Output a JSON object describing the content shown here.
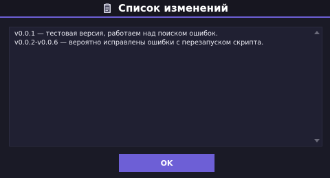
{
  "dialog": {
    "title": "Список изменений",
    "title_icon": "clipboard-icon"
  },
  "changelog": {
    "lines": [
      "v0.0.1 — тестовая версия, работаем над поиском ошибок.",
      "v0.0.2-v0.0.6 — вероятно исправлены ошибки с перезапуском скрипта."
    ]
  },
  "buttons": {
    "ok_label": "OK"
  },
  "colors": {
    "background": "#1a1a26",
    "accent": "#6d5fd6",
    "textbox_bg": "#202032",
    "text": "#e8e8f0"
  }
}
